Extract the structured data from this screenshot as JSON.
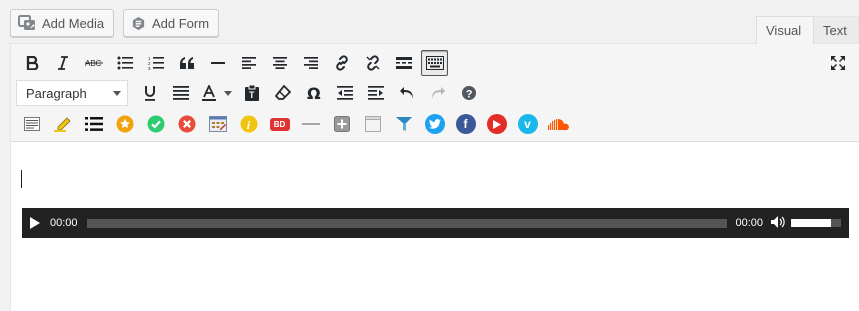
{
  "top_buttons": {
    "add_media": "Add Media",
    "add_form": "Add Form"
  },
  "tabs": {
    "visual": "Visual",
    "text": "Text",
    "active": "visual"
  },
  "toolbar": {
    "row1": [
      "bold-icon",
      "italic-icon",
      "strikethrough-icon",
      "bullet-list-icon",
      "numbered-list-icon",
      "blockquote-icon",
      "horizontal-line-icon",
      "align-left-icon",
      "align-center-icon",
      "align-right-icon",
      "insert-link-icon",
      "remove-link-icon",
      "read-more-icon",
      "toolbar-toggle-icon"
    ],
    "format_select": {
      "selected": "Paragraph"
    },
    "row2": [
      "underline-icon",
      "justify-icon",
      "text-color-icon",
      "paste-text-icon",
      "clear-formatting-icon",
      "special-character-icon",
      "outdent-icon",
      "indent-icon",
      "undo-icon",
      "redo-icon",
      "help-icon"
    ],
    "row3": [
      "text-document-icon",
      "highlighter-icon",
      "list-icon",
      "star-badge-icon",
      "check-badge-icon",
      "cross-badge-icon",
      "calendar-icon",
      "info-icon",
      "bd-badge-icon",
      "divider-icon",
      "plus-box-icon",
      "note-icon",
      "flag-icon",
      "twitter-icon",
      "facebook-icon",
      "youtube-icon",
      "vimeo-icon",
      "soundcloud-icon"
    ],
    "bd_badge_text": "BD",
    "fullscreen": "fullscreen-icon"
  },
  "audio_player": {
    "current_time": "00:00",
    "duration": "00:00",
    "progress": 0,
    "volume": 0.8
  },
  "colors": {
    "star": "#f0a30a",
    "check": "#2ecc71",
    "cross": "#e74c3c",
    "info": "#f1c40f",
    "twitter": "#1da1f2",
    "facebook": "#3b5998",
    "youtube": "#e52d27",
    "vimeo": "#1ab7ea",
    "soundcloud": "#ff5500"
  }
}
